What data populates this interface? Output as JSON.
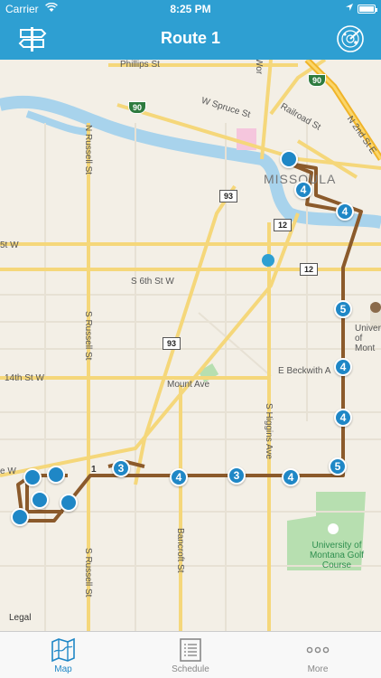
{
  "status": {
    "carrier": "Carrier",
    "time": "8:25 PM"
  },
  "nav": {
    "title": "Route 1",
    "left_icon": "signpost-icon",
    "right_icon": "radar-icon"
  },
  "map": {
    "labels": {
      "phillips": "Phillips St",
      "spruce": "W Spruce St",
      "railroad": "Railroad St",
      "n2nd": "N 2nd St E",
      "missoula": "MISSOULA",
      "n_russell": "N Russell St",
      "s5th": "5t W",
      "s6th": "S 6th St W",
      "s14th": "14th St W",
      "mount": "Mount Ave",
      "beckwith": "E Beckwith A",
      "s_russell": "S Russell St",
      "s_russell2": "S Russell St",
      "higgins": "S Higgins Ave",
      "bancroft": "Bancroft St",
      "univ": "Univer of Mont",
      "golf": "University of Montana Golf Course",
      "legal": "Legal",
      "north_partial": "Wor",
      "we": "e W"
    },
    "shields": {
      "i90_a": "90",
      "i90_b": "90",
      "us93_a": "93",
      "us93_b": "93",
      "r12_a": "12",
      "r12_b": "12",
      "one": "1"
    },
    "stops": [
      "",
      "4",
      "4",
      "5",
      "4",
      "4",
      "5",
      "4",
      "3",
      "4",
      "3",
      "",
      "",
      "",
      "",
      ""
    ]
  },
  "tabs": [
    {
      "label": "Map",
      "icon": "map-icon"
    },
    {
      "label": "Schedule",
      "icon": "schedule-icon"
    },
    {
      "label": "More",
      "icon": "more-icon"
    }
  ],
  "colors": {
    "header": "#2e9fd2",
    "stop": "#1f87c6",
    "route": "#8b5a2b",
    "river": "#a8d3ec",
    "park": "#b7dfb0"
  }
}
